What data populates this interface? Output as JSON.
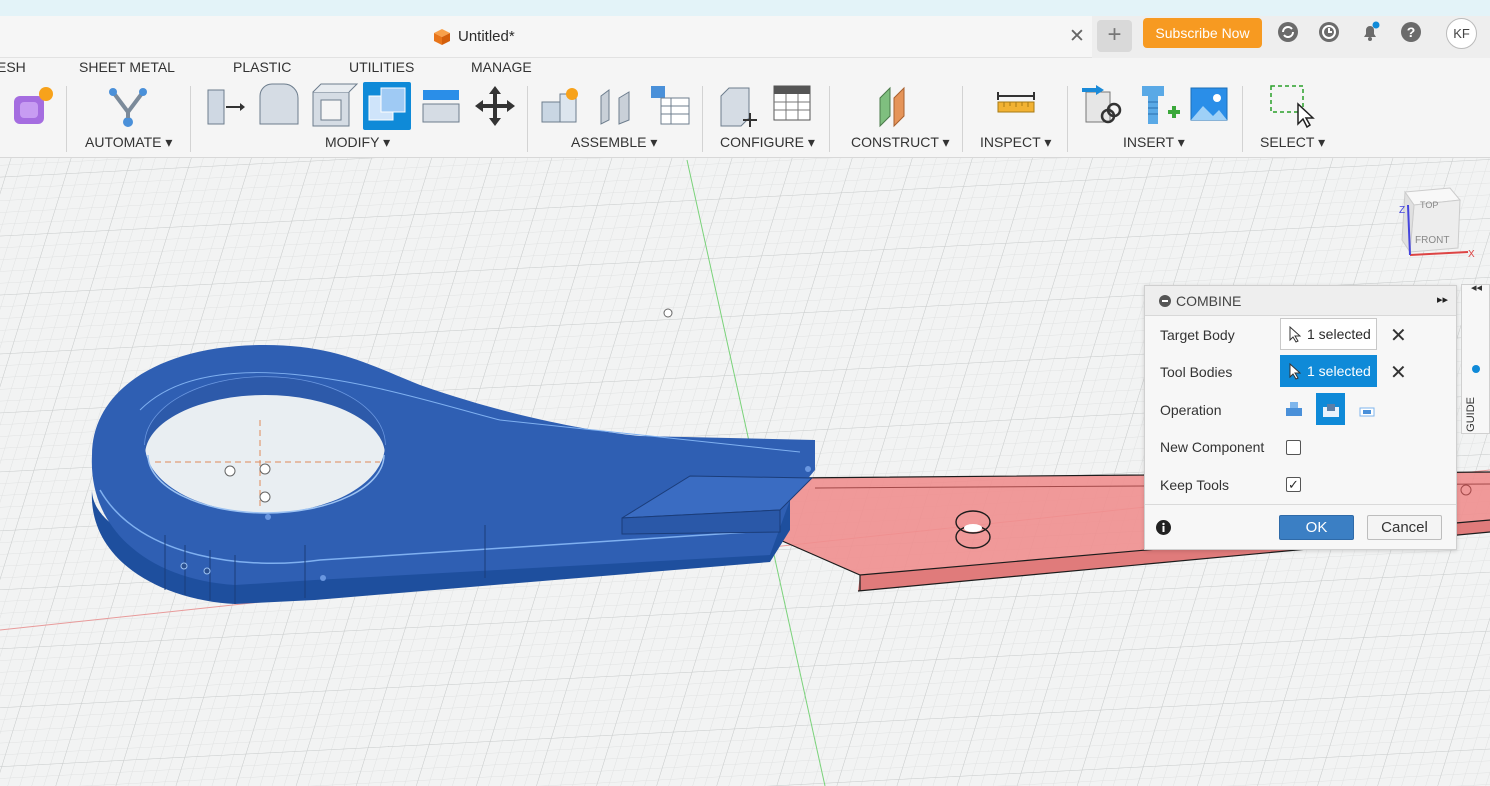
{
  "document": {
    "title": "Untitled*"
  },
  "header": {
    "subscribe_label": "Subscribe Now",
    "avatar_initials": "KF"
  },
  "workspace_tabs": [
    "ESH",
    "SHEET METAL",
    "PLASTIC",
    "UTILITIES",
    "MANAGE"
  ],
  "tool_groups": [
    "AUTOMATE ▾",
    "MODIFY ▾",
    "ASSEMBLE ▾",
    "CONFIGURE ▾",
    "CONSTRUCT ▾",
    "INSPECT ▾",
    "INSERT ▾",
    "SELECT ▾"
  ],
  "viewcube": {
    "top": "TOP",
    "front": "FRONT",
    "axis_x": "X",
    "axis_z": "Z"
  },
  "guide_label": "GUIDE",
  "combine": {
    "title": "COMBINE",
    "target_body_label": "Target Body",
    "target_body_value": "1 selected",
    "tool_bodies_label": "Tool Bodies",
    "tool_bodies_value": "1 selected",
    "operation_label": "Operation",
    "operation_selected": "cut",
    "new_component_label": "New Component",
    "new_component_checked": false,
    "keep_tools_label": "Keep Tools",
    "keep_tools_checked": true,
    "ok_label": "OK",
    "cancel_label": "Cancel",
    "keep_tools_mark": "✓"
  },
  "colors": {
    "accent": "#0f8ad8",
    "subscribe": "#f79a21",
    "body_blue": "#2f5fb3",
    "body_red": "#f08f8f"
  }
}
